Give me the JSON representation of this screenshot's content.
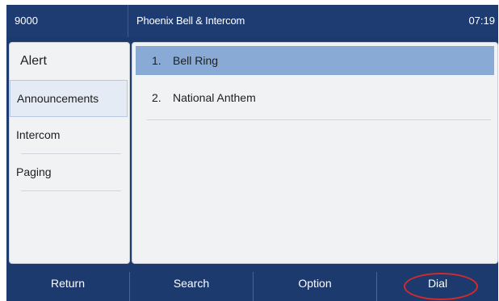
{
  "status_bar": {
    "extension": "9000",
    "title": "Phoenix Bell & Intercom",
    "time": "07:19"
  },
  "sidebar": {
    "items": [
      {
        "label": "Alert"
      },
      {
        "label": "Announcements"
      },
      {
        "label": "Intercom"
      },
      {
        "label": "Paging"
      }
    ]
  },
  "list": {
    "items": [
      {
        "number": "1.",
        "label": "Bell Ring"
      },
      {
        "number": "2.",
        "label": "National Anthem"
      }
    ]
  },
  "softkeys": [
    {
      "label": "Return"
    },
    {
      "label": "Search"
    },
    {
      "label": "Option"
    },
    {
      "label": "Dial"
    }
  ],
  "colors": {
    "chrome": "#1d3a6e",
    "selection": "#8aaad6",
    "panel": "#f1f2f4",
    "highlight_ring": "#d62a2a"
  }
}
